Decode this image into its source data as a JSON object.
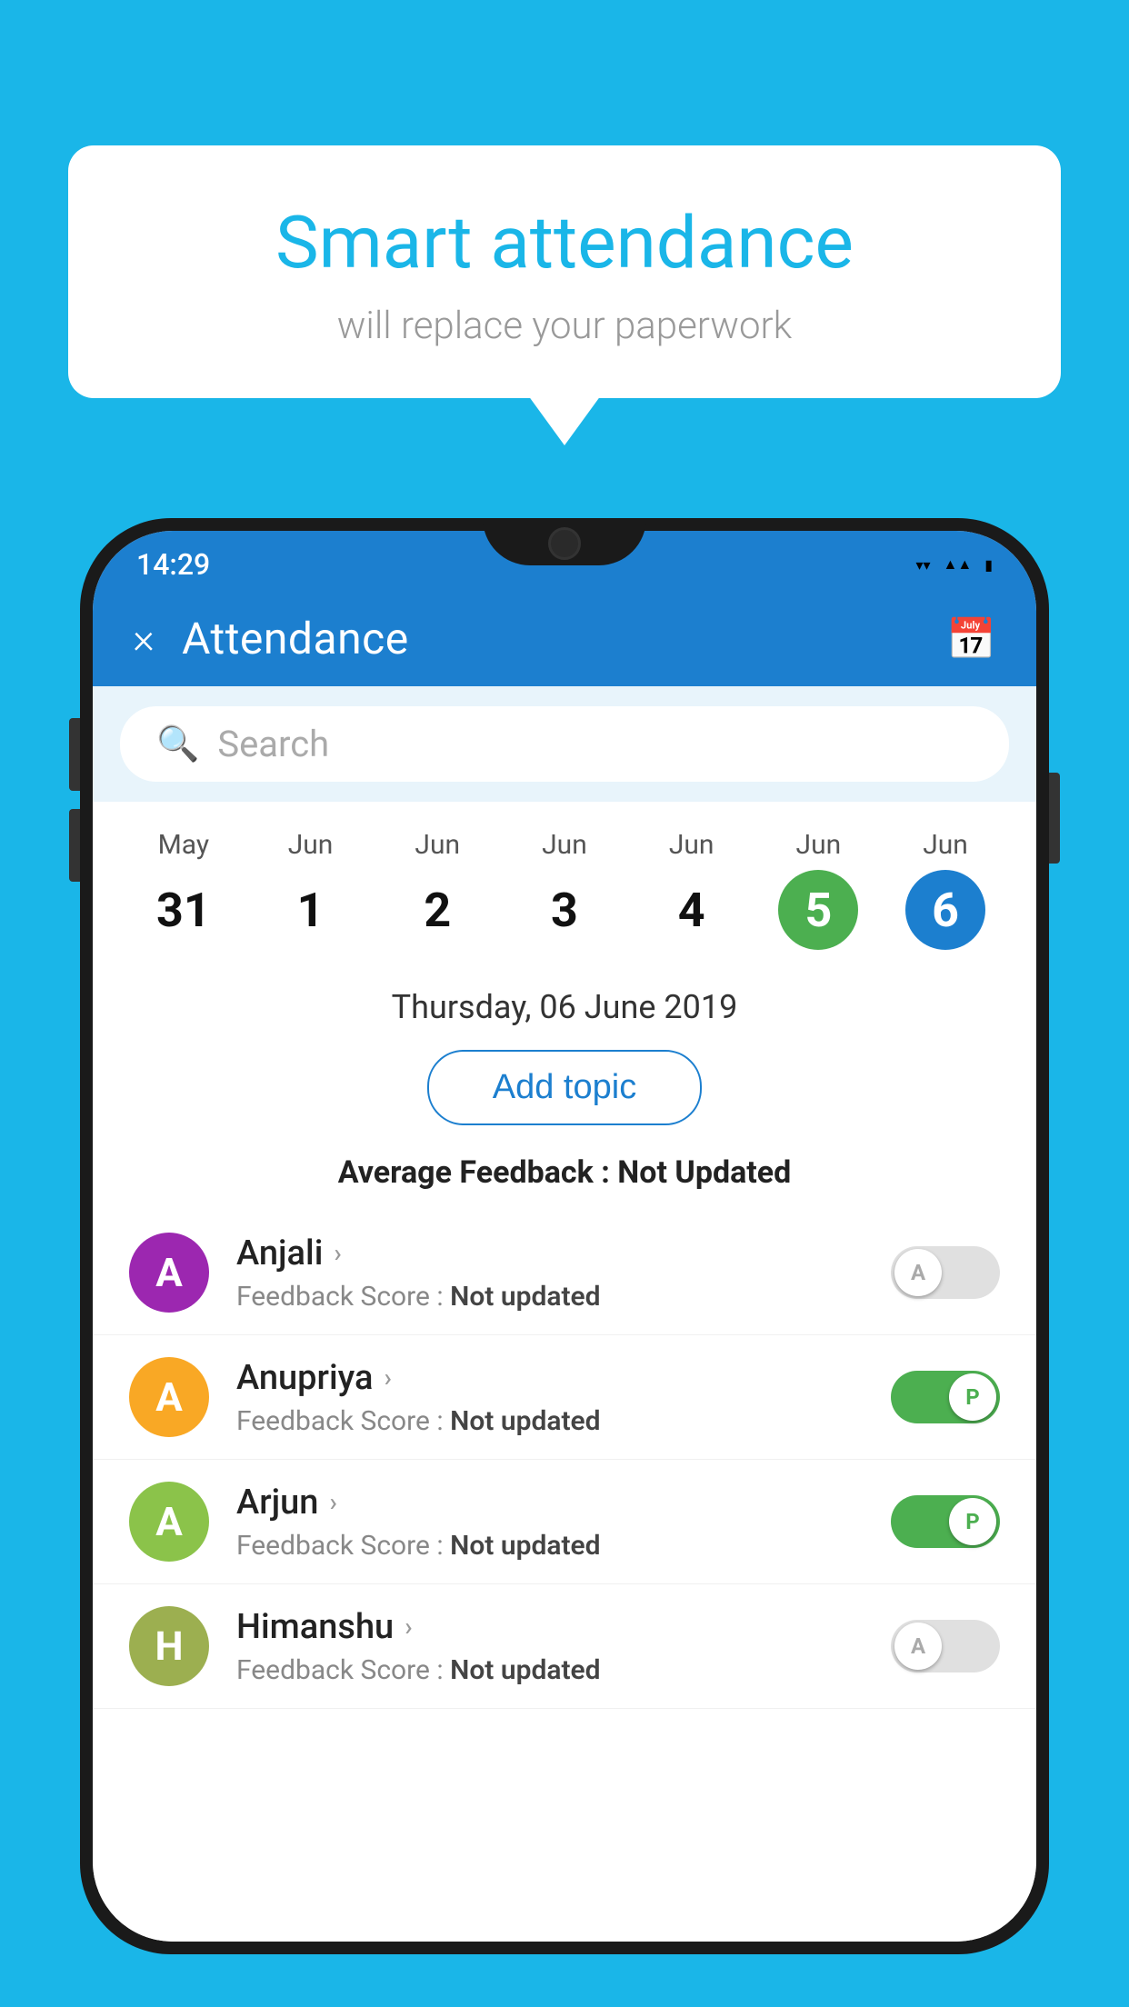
{
  "background_color": "#1ab6e8",
  "bubble": {
    "title": "Smart attendance",
    "subtitle": "will replace your paperwork"
  },
  "status_bar": {
    "time": "14:29",
    "icons": [
      "wifi",
      "signal",
      "battery"
    ]
  },
  "app_bar": {
    "title": "Attendance",
    "close_label": "×",
    "calendar_icon": "📅"
  },
  "search": {
    "placeholder": "Search"
  },
  "calendar": {
    "days": [
      {
        "month": "May",
        "num": "31",
        "highlight": "none"
      },
      {
        "month": "Jun",
        "num": "1",
        "highlight": "none"
      },
      {
        "month": "Jun",
        "num": "2",
        "highlight": "none"
      },
      {
        "month": "Jun",
        "num": "3",
        "highlight": "none"
      },
      {
        "month": "Jun",
        "num": "4",
        "highlight": "none"
      },
      {
        "month": "Jun",
        "num": "5",
        "highlight": "green"
      },
      {
        "month": "Jun",
        "num": "6",
        "highlight": "blue"
      }
    ]
  },
  "selected_date": "Thursday, 06 June 2019",
  "add_topic_label": "Add topic",
  "avg_feedback": {
    "label": "Average Feedback : ",
    "value": "Not Updated"
  },
  "students": [
    {
      "name": "Anjali",
      "avatar_letter": "A",
      "avatar_color": "av-purple",
      "feedback_label": "Feedback Score : ",
      "feedback_value": "Not updated",
      "toggle_state": "off",
      "toggle_letter": "A"
    },
    {
      "name": "Anupriya",
      "avatar_letter": "A",
      "avatar_color": "av-yellow",
      "feedback_label": "Feedback Score : ",
      "feedback_value": "Not updated",
      "toggle_state": "on",
      "toggle_letter": "P"
    },
    {
      "name": "Arjun",
      "avatar_letter": "A",
      "avatar_color": "av-green",
      "feedback_label": "Feedback Score : ",
      "feedback_value": "Not updated",
      "toggle_state": "on",
      "toggle_letter": "P"
    },
    {
      "name": "Himanshu",
      "avatar_letter": "H",
      "avatar_color": "av-olive",
      "feedback_label": "Feedback Score : ",
      "feedback_value": "Not updated",
      "toggle_state": "off",
      "toggle_letter": "A"
    }
  ]
}
